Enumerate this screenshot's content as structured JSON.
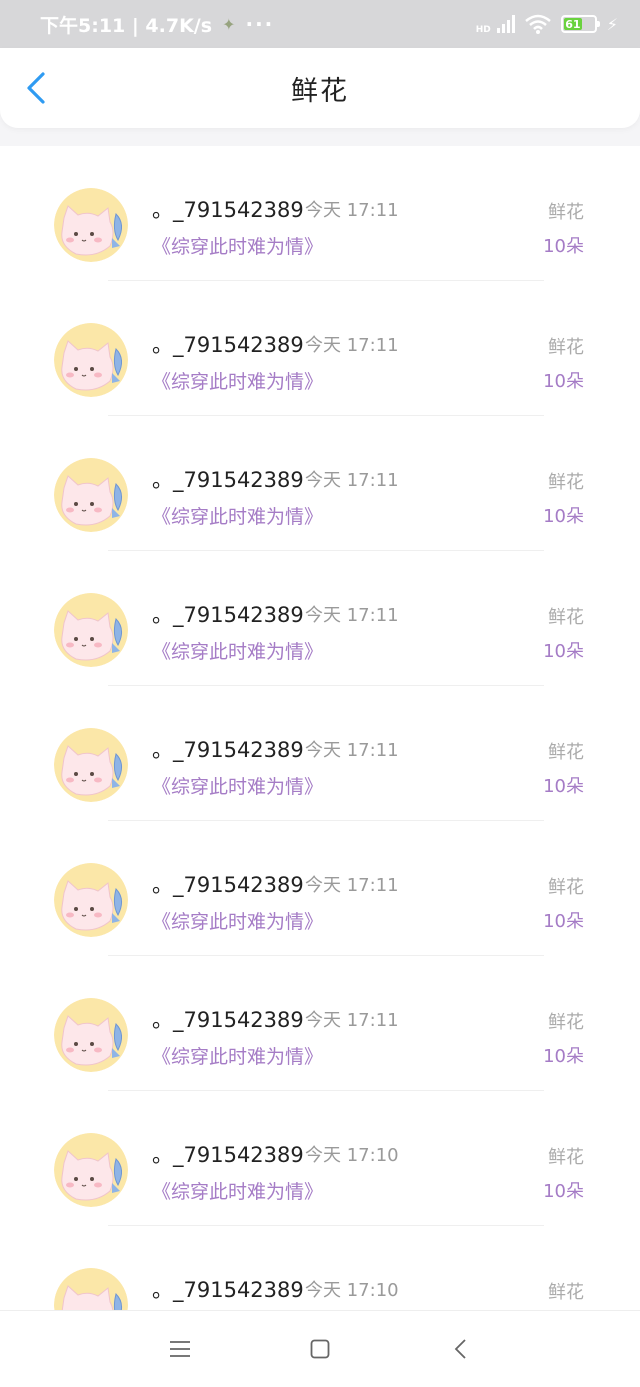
{
  "status_bar": {
    "time_speed": "下午5:11 | 4.7K/s",
    "more": "···",
    "network": "HD",
    "battery_level": 61,
    "battery_label": "61",
    "battery_color": "#6ad23e"
  },
  "header": {
    "title": "鲜花",
    "accent_color": "#2f9bf2"
  },
  "gifts": [
    {
      "user": "。_791542389",
      "time": "今天 17:11",
      "book": "《综穿此时难为情》",
      "type": "鲜花",
      "count": "10朵"
    },
    {
      "user": "。_791542389",
      "time": "今天 17:11",
      "book": "《综穿此时难为情》",
      "type": "鲜花",
      "count": "10朵"
    },
    {
      "user": "。_791542389",
      "time": "今天 17:11",
      "book": "《综穿此时难为情》",
      "type": "鲜花",
      "count": "10朵"
    },
    {
      "user": "。_791542389",
      "time": "今天 17:11",
      "book": "《综穿此时难为情》",
      "type": "鲜花",
      "count": "10朵"
    },
    {
      "user": "。_791542389",
      "time": "今天 17:11",
      "book": "《综穿此时难为情》",
      "type": "鲜花",
      "count": "10朵"
    },
    {
      "user": "。_791542389",
      "time": "今天 17:11",
      "book": "《综穿此时难为情》",
      "type": "鲜花",
      "count": "10朵"
    },
    {
      "user": "。_791542389",
      "time": "今天 17:11",
      "book": "《综穿此时难为情》",
      "type": "鲜花",
      "count": "10朵"
    },
    {
      "user": "。_791542389",
      "time": "今天 17:10",
      "book": "《综穿此时难为情》",
      "type": "鲜花",
      "count": "10朵"
    },
    {
      "user": "。_791542389",
      "time": "今天 17:10",
      "book": "",
      "type": "鲜花",
      "count": ""
    }
  ],
  "nav": {
    "menu_icon": "menu-icon",
    "home_icon": "home-square-icon",
    "back_icon": "back-triangle-icon"
  }
}
